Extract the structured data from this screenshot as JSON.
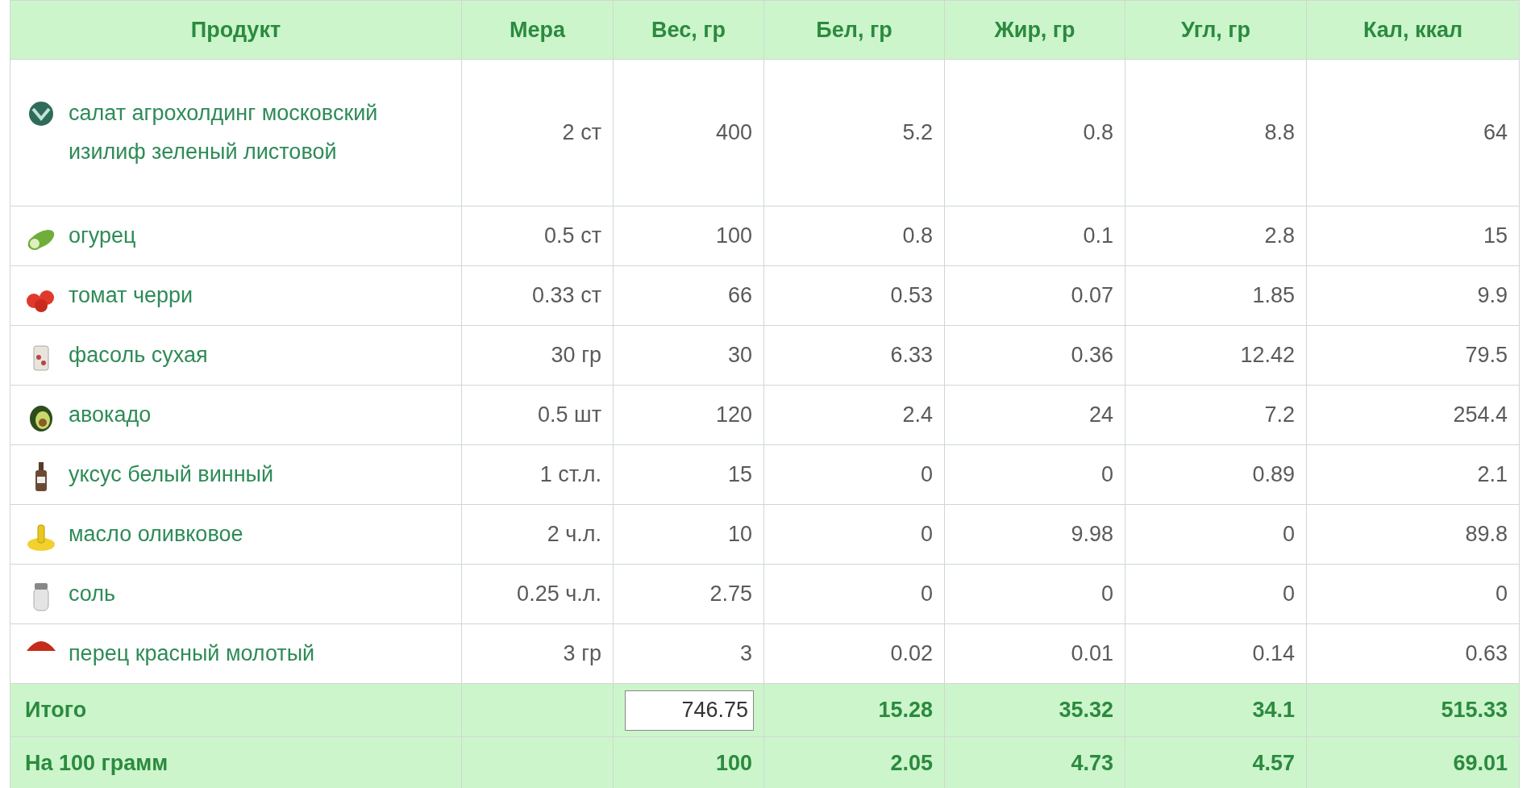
{
  "table": {
    "columns": [
      "Продукт",
      "Мера",
      "Вес, гр",
      "Бел, гр",
      "Жир, гр",
      "Угл, гр",
      "Кал, ккал"
    ],
    "rows": [
      {
        "product": "салат агрохолдинг московский изилиф зеленый листовой",
        "measure": "2 ст",
        "weight": "400",
        "protein": "5.2",
        "fat": "0.8",
        "carbs": "8.8",
        "kcal": "64"
      },
      {
        "product": "огурец",
        "measure": "0.5 ст",
        "weight": "100",
        "protein": "0.8",
        "fat": "0.1",
        "carbs": "2.8",
        "kcal": "15"
      },
      {
        "product": "томат черри",
        "measure": "0.33 ст",
        "weight": "66",
        "protein": "0.53",
        "fat": "0.07",
        "carbs": "1.85",
        "kcal": "9.9"
      },
      {
        "product": "фасоль сухая",
        "measure": "30 гр",
        "weight": "30",
        "protein": "6.33",
        "fat": "0.36",
        "carbs": "12.42",
        "kcal": "79.5"
      },
      {
        "product": "авокадо",
        "measure": "0.5 шт",
        "weight": "120",
        "protein": "2.4",
        "fat": "24",
        "carbs": "7.2",
        "kcal": "254.4"
      },
      {
        "product": "уксус белый винный",
        "measure": "1 ст.л.",
        "weight": "15",
        "protein": "0",
        "fat": "0",
        "carbs": "0.89",
        "kcal": "2.1"
      },
      {
        "product": "масло оливковое",
        "measure": "2 ч.л.",
        "weight": "10",
        "protein": "0",
        "fat": "9.98",
        "carbs": "0",
        "kcal": "89.8"
      },
      {
        "product": "соль",
        "measure": "0.25 ч.л.",
        "weight": "2.75",
        "protein": "0",
        "fat": "0",
        "carbs": "0",
        "kcal": "0"
      },
      {
        "product": "перец красный молотый",
        "measure": "3 гр",
        "weight": "3",
        "protein": "0.02",
        "fat": "0.01",
        "carbs": "0.14",
        "kcal": "0.63"
      }
    ],
    "totals": [
      {
        "kind": "input",
        "label": "Итого",
        "weight": "746.75",
        "protein": "15.28",
        "fat": "35.32",
        "carbs": "34.1",
        "kcal": "515.33"
      },
      {
        "kind": "text",
        "label": "На 100 грамм",
        "weight": "100",
        "protein": "2.05",
        "fat": "4.73",
        "carbs": "4.57",
        "kcal": "69.01"
      }
    ]
  }
}
